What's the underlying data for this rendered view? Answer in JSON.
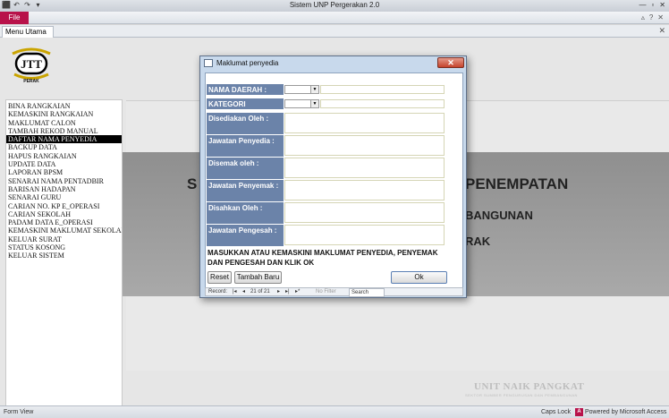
{
  "window": {
    "title": "Sistem UNP Pergerakan 2.0",
    "qat": [
      "⬛",
      "↶",
      "↷",
      "▾"
    ],
    "controls": [
      "—",
      "▫",
      "✕"
    ]
  },
  "ribbon": {
    "file_tab": "File",
    "controls": [
      "▵",
      "?",
      "✕"
    ]
  },
  "doc_tab": {
    "label": "Menu Utama",
    "close": "✕"
  },
  "logo": {
    "text": "JTT",
    "caption": "PERAK"
  },
  "menu": {
    "items": [
      "BINA RANGKAIAN",
      "KEMASKINI RANGKAIAN",
      "MAKLUMAT CALON",
      "TAMBAH REKOD MANUAL",
      "DAFTAR NAMA PENYEDIA",
      "BACKUP DATA",
      "HAPUS RANGKAIAN",
      "UPDATE DATA",
      "LAPORAN BPSM",
      "SENARAI NAMA PENTADBIR",
      "BARISAN HADAPAN",
      "SENARAI GURU",
      "CARIAN NO. KP E_OPERASI",
      "CARIAN SEKOLAH",
      "PADAM DATA E_OPERASI",
      "KEMASKINI MAKLUMAT SEKOLAH",
      "KELUAR SURAT",
      "STATUS KOSONG",
      "KELUAR SISTEM"
    ],
    "selected_index": 4
  },
  "background_band": {
    "text1": "S",
    "text2": "PENEMPATAN",
    "text3": "BANGUNAN",
    "text4": "RAK"
  },
  "watermark": {
    "title": "UNIT NAIK PANGKAT",
    "subtitle": "SEKTOR SUMBER PENGURUSAN DAN PEMBANGUNAN"
  },
  "dialog": {
    "title": "Maklumat penyedia",
    "close": "✕",
    "fields": {
      "nama_daerah": "NAMA DAERAH :",
      "kategori_institusi": "KATEGORI INSTITUSI :",
      "disediakan_oleh": "Disediakan Oleh :",
      "jawatan_penyedia": "Jawatan Penyedia :",
      "disemak_oleh": "Disemak oleh :",
      "jawatan_penyemak": "Jawatan Penyemak :",
      "disahkan_oleh": "Disahkan Oleh :",
      "jawatan_pengesah": "Jawatan Pengesah :"
    },
    "dropdown_arrow": "▼",
    "message": "MASUKKAN ATAU KEMASKINI MAKLUMAT PENYEDIA, PENYEMAK DAN PENGESAH DAN KLIK OK",
    "buttons": {
      "reset": "Reset",
      "tambah_baru": "Tambah Baru",
      "ok": "Ok"
    },
    "record_nav": {
      "label": "Record:",
      "first": "|◂",
      "prev": "◂",
      "position": "21 of 21",
      "next": "▸",
      "last": "▸|",
      "new": "▸*",
      "filter": "No Filter",
      "search": "Search"
    }
  },
  "status": {
    "left": "Form View",
    "caps": "Caps Lock",
    "access_icon": "A",
    "powered": "Powered by Microsoft Access"
  }
}
